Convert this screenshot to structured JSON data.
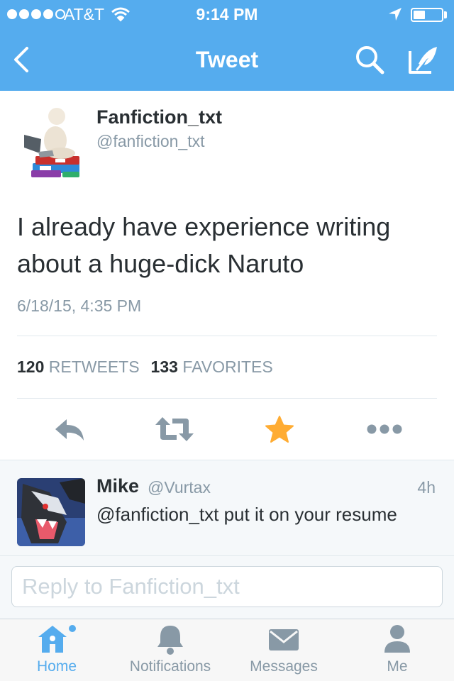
{
  "status_bar": {
    "carrier": "AT&T",
    "time": "9:14 PM",
    "signal_bars": 4,
    "signal_total": 5,
    "battery_level": 0.3,
    "icons": [
      "wifi-icon",
      "location-arrow-icon",
      "battery-icon"
    ]
  },
  "nav": {
    "title": "Tweet",
    "back_icon": "chevron-left-icon",
    "search_icon": "search-icon",
    "compose_icon": "compose-feather-icon"
  },
  "tweet": {
    "name": "Fanfiction_txt",
    "handle": "@fanfiction_txt",
    "text": "I already have experience writing about a huge-dick Naruto",
    "date": "6/18/15, 4:35 PM",
    "retweets_count": "120",
    "retweets_label": "RETWEETS",
    "favorites_count": "133",
    "favorites_label": "FAVORITES",
    "avatar_icon": "figure-on-books-avatar"
  },
  "actions": [
    {
      "name": "reply",
      "icon": "reply-arrow-icon"
    },
    {
      "name": "retweet",
      "icon": "retweet-icon"
    },
    {
      "name": "favorite",
      "icon": "star-icon",
      "active": true
    },
    {
      "name": "more",
      "icon": "more-dots-icon"
    }
  ],
  "reply": {
    "name": "Mike",
    "handle": "@Vurtax",
    "time": "4h",
    "text": "@fanfiction_txt put it on your resume",
    "avatar_icon": "creature-avatar"
  },
  "compose": {
    "placeholder": "Reply to Fanfiction_txt"
  },
  "tabs": [
    {
      "label": "Home",
      "icon": "home-icon",
      "active": true,
      "has_dot": true
    },
    {
      "label": "Notifications",
      "icon": "bell-icon",
      "active": false
    },
    {
      "label": "Messages",
      "icon": "envelope-icon",
      "active": false
    },
    {
      "label": "Me",
      "icon": "person-icon",
      "active": false
    }
  ],
  "colors": {
    "brand": "#55acee",
    "favorite": "#ffac33",
    "muted": "#8899a6",
    "text": "#292f33",
    "icon_grey": "#8899a6"
  }
}
